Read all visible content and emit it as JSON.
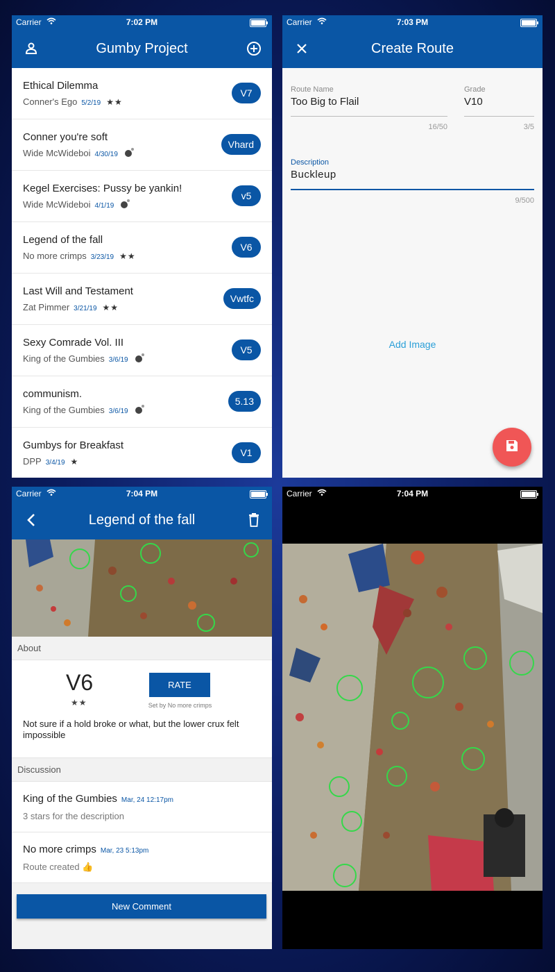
{
  "status_bars": [
    {
      "carrier": "Carrier",
      "time": "7:02 PM"
    },
    {
      "carrier": "Carrier",
      "time": "7:03 PM"
    },
    {
      "carrier": "Carrier",
      "time": "7:04 PM"
    },
    {
      "carrier": "Carrier",
      "time": "7:04 PM"
    }
  ],
  "list_screen": {
    "title": "Gumby Project",
    "left_icon": "person-icon",
    "right_icon": "add-circle-icon",
    "routes": [
      {
        "name": "Ethical Dilemma",
        "setter": "Conner's Ego",
        "date": "5/2/19",
        "rating": "★★",
        "grade": "V7"
      },
      {
        "name": "Conner you're soft",
        "setter": "Wide McWideboi",
        "date": "4/30/19",
        "rating_icon": "bomb-icon",
        "grade": "Vhard"
      },
      {
        "name": "Kegel Exercises: Pussy be yankin!",
        "setter": "Wide McWideboi",
        "date": "4/1/19",
        "rating_icon": "bomb-icon",
        "grade": "v5"
      },
      {
        "name": "Legend of the fall",
        "setter": "No more crimps",
        "date": "3/23/19",
        "rating": "★★",
        "grade": "V6"
      },
      {
        "name": "Last Will and Testament",
        "setter": "Zat Pimmer",
        "date": "3/21/19",
        "rating": "★★",
        "grade": "Vwtfc"
      },
      {
        "name": "Sexy Comrade Vol. III",
        "setter": "King of the Gumbies",
        "date": "3/6/19",
        "rating_icon": "bomb-icon",
        "grade": "V5"
      },
      {
        "name": "communism.",
        "setter": "King of the Gumbies",
        "date": "3/6/19",
        "rating_icon": "bomb-icon",
        "grade": "5.13"
      },
      {
        "name": "Gumbys for Breakfast",
        "setter": "DPP",
        "date": "3/4/19",
        "rating": "★",
        "grade": "V1"
      }
    ]
  },
  "create_screen": {
    "title": "Create Route",
    "close_icon": "close-icon",
    "route_name": {
      "label": "Route Name",
      "value": "Too Big to Flail",
      "counter": "16/50"
    },
    "grade": {
      "label": "Grade",
      "value": "V10",
      "counter": "3/5"
    },
    "description": {
      "label": "Description",
      "value": "Buckleup",
      "counter": "9/500"
    },
    "add_image": "Add Image",
    "save_icon": "save-icon",
    "colors": {
      "accent": "#0a56a5",
      "fab": "#f05656",
      "link": "#2a9fd8"
    }
  },
  "detail_screen": {
    "title": "Legend of the fall",
    "back_icon": "back-chevron-icon",
    "delete_icon": "trash-icon",
    "about_header": "About",
    "grade": "V6",
    "rating": "★★",
    "rate_button": "RATE",
    "set_by": "Set by No more crimps",
    "description": "Not sure if a hold broke or what, but the lower crux felt impossible",
    "discussion_header": "Discussion",
    "comments": [
      {
        "author": "King of the Gumbies",
        "time": "Mar, 24 12:17pm",
        "text": "3 stars for the description"
      },
      {
        "author": "No more crimps",
        "time": "Mar, 23 5:13pm",
        "text": "Route created 👍"
      }
    ],
    "new_comment_button": "New Comment"
  },
  "photo_screen": {
    "image": "climbing-wall-photo"
  }
}
